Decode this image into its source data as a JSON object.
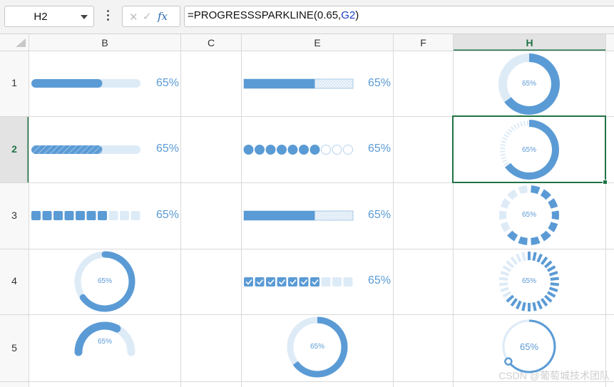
{
  "name_box": {
    "value": "H2"
  },
  "formula": {
    "prefix": "=PROGRESSSPARKLINE(0.65,",
    "ref": "G2",
    "suffix": ")"
  },
  "fx_label": "fx",
  "columns": [
    "B",
    "C",
    "E",
    "F",
    "H"
  ],
  "active_column": "H",
  "rows": [
    "1",
    "2",
    "3",
    "4",
    "5"
  ],
  "active_row": "2",
  "selected_cell": "H2",
  "progress": 0.65,
  "percent_label": "65%",
  "watermark": "CSDN @葡萄城技术团队",
  "colors": {
    "accent": "#5b9bd5",
    "track": "#ddebf7",
    "header_active": "#217346"
  }
}
